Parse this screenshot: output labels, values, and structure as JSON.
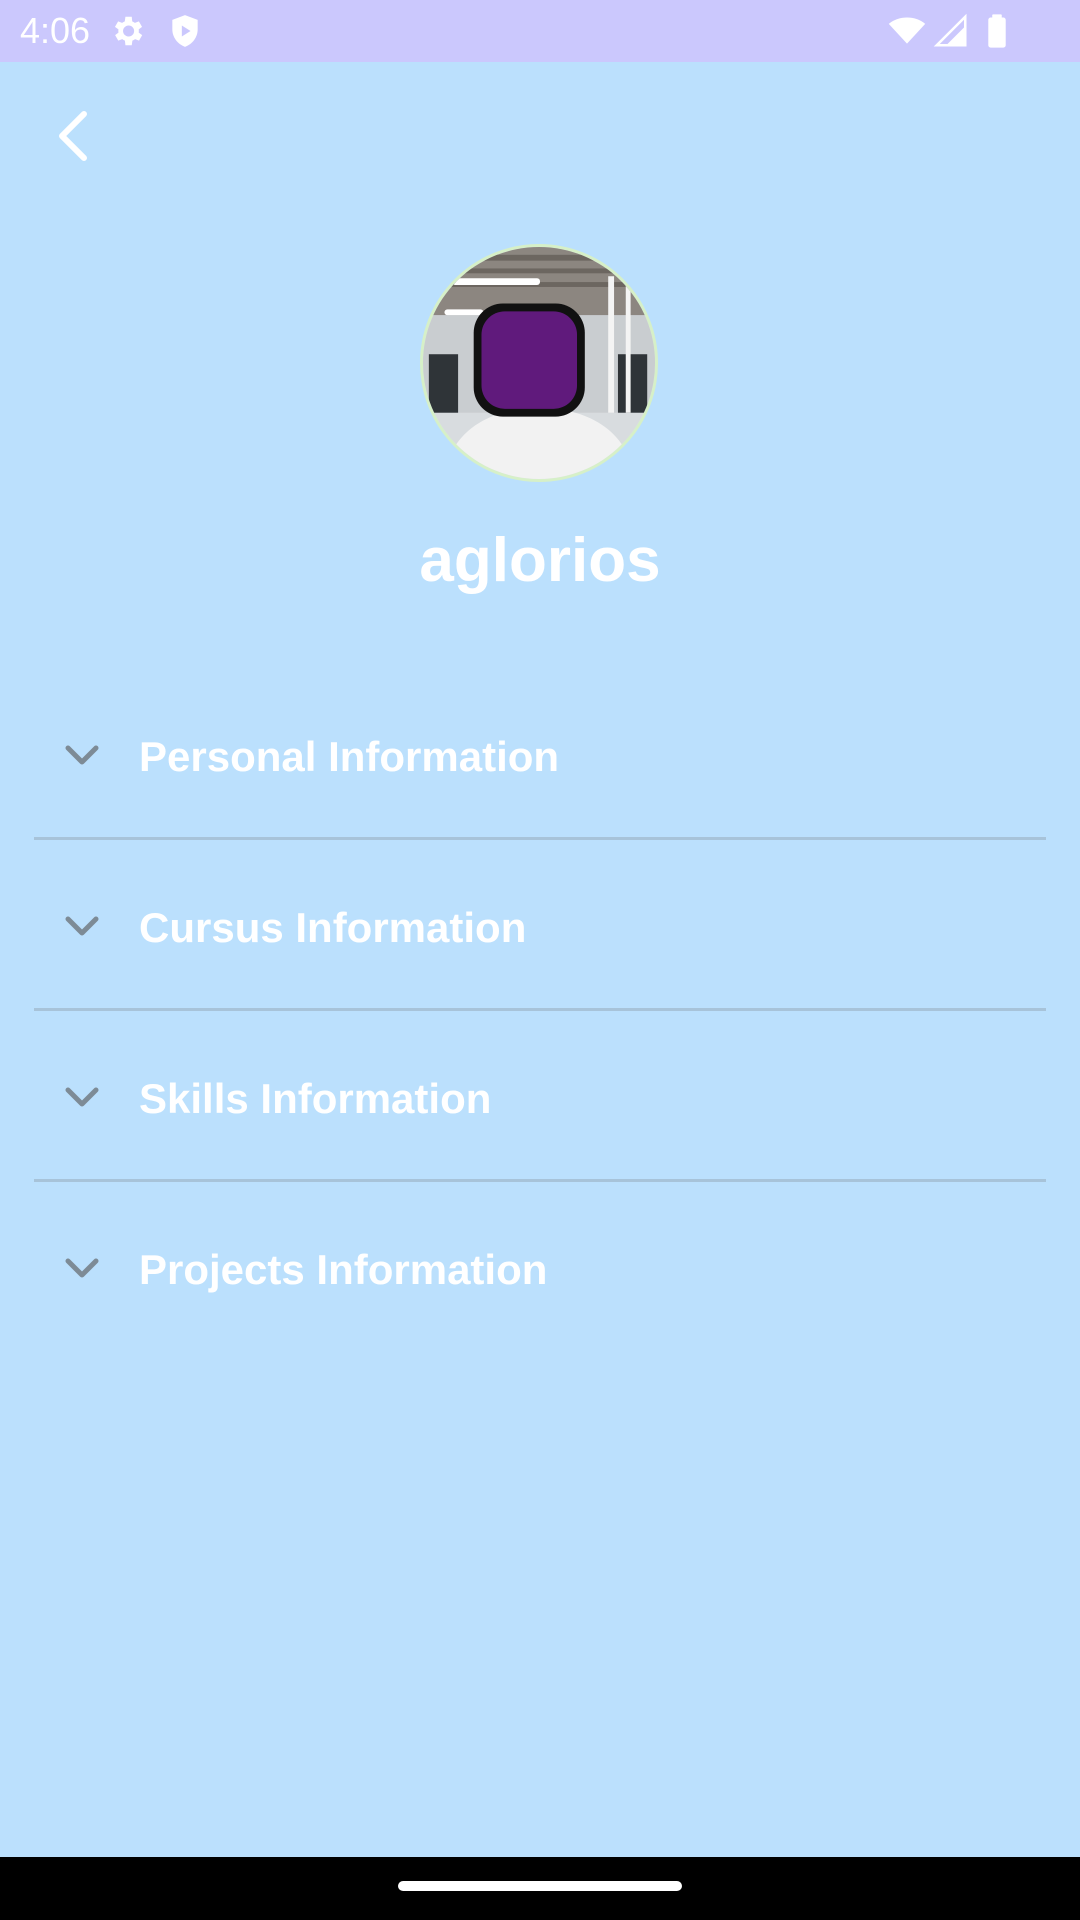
{
  "status_bar": {
    "time": "4:06",
    "icons": [
      "gear-icon",
      "shield-play-icon",
      "wifi-icon",
      "cell-signal-icon",
      "battery-icon"
    ],
    "background_color": "#cbc8fd"
  },
  "header": {
    "back_icon": "chevron-left-icon"
  },
  "profile": {
    "username": "aglorios",
    "avatar_badge_color": "#601a7c"
  },
  "sections": [
    {
      "label": "Personal Information",
      "icon": "chevron-down-icon"
    },
    {
      "label": "Cursus Information",
      "icon": "chevron-down-icon"
    },
    {
      "label": "Skills Information",
      "icon": "chevron-down-icon"
    },
    {
      "label": "Projects Information",
      "icon": "chevron-down-icon"
    }
  ],
  "colors": {
    "background": "#bbe0fd",
    "divider": "#a7c3d9",
    "chevron": "#7d8b96",
    "text": "#ffffff"
  }
}
